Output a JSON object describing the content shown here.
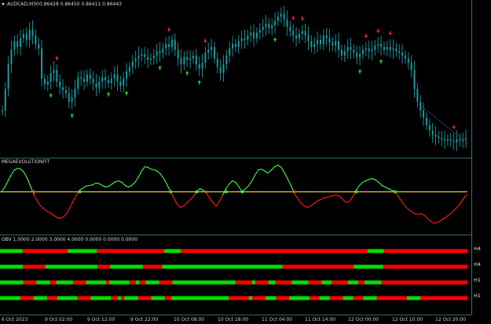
{
  "colors": {
    "background": "#000000",
    "grid": "#4c8a8a",
    "candles": "#1c9aa0",
    "up_arrow": "#22e022",
    "down_arrow": "#ff2020",
    "oscillator_up": "#44ff44",
    "oscillator_down": "#ff1c1c",
    "zero_line": "#e8c83c",
    "strip_green": "#00e000",
    "strip_red": "#ff0000"
  },
  "price_panel": {
    "title": "AUDCAD,M30",
    "ohlc": "0.86428 0.86450 0.86411 0.86443",
    "collapse_icon": "triangle-down-icon"
  },
  "oscillator_panel": {
    "title": "MEGAEVOLUTIONFIT"
  },
  "strip_panel": {
    "title": "OBV  1.0000  2.0000  3.0000  4.0000  0.0000  0.0000  0.0000",
    "rows": [
      {
        "label": "H4",
        "pattern": "gggggggrrrrrrrrrrrrrrgggggggggrrrrrrrrrrrrrrrrrrrrrgggggrrrrrrrrrrrrrrrrrrrrrrrrrrrrrrrrrrrrrrrrrrrrrrrrrrrrrrrrrrgggggrrrrrrrrrrrrrrrrrrrrrrrrrr"
      },
      {
        "label": "H4",
        "pattern": "gggggggrrrrrrrggggggggggggggggrrrrggggggggggrrrrrrgggggggggggggggggggggggggggggggggggggrrrrrrrrrrrrrrrrrrrrrrgggggggggrrrrrrrrrrrrrrrrrrrrrrrrrr"
      },
      {
        "label": "H1",
        "pattern": "gggggggrrrrggggrrgggggrrrrggggggrggggggrrgrrggggrrrrgggggggggggggggggggrrrrrgrrrrggrrrrrgggggrrrrgggrrrrrgggrrgggggrrrrrrrrrrrrrrrrrrrrrrrrrr"
      },
      {
        "label": "H1",
        "pattern": "ggggggrrrrggggrrrggggggrrrrggggggrrgrggggrrrrggggrrgggggggggggggggggrrrrrrgrrrrgggrrrrggggggrrrgggrrrrgggrrrggggrrrrrrrrrggggrrrrrrrrrrrrrr"
      }
    ]
  },
  "time_axis": [
    "6 Oct 2023",
    "9 Oct 02:00",
    "9 Oct 12:00",
    "9 Oct 22:00",
    "10 Oct 08:00",
    "10 Oct 18:00",
    "11 Oct 04:00",
    "11 Oct 14:00",
    "12 Oct 00:00",
    "12 Oct 10:00",
    "12 Oct 20:00"
  ],
  "chart_data": [
    {
      "type": "candlestick",
      "symbol": "AUDCAD",
      "timeframe": "M30",
      "closes": [
        0.3,
        0.45,
        0.62,
        0.72,
        0.78,
        0.74,
        0.8,
        0.83,
        0.79,
        0.86,
        0.82,
        0.76,
        0.73,
        0.52,
        0.48,
        0.5,
        0.56,
        0.58,
        0.5,
        0.46,
        0.44,
        0.42,
        0.36,
        0.39,
        0.45,
        0.53,
        0.52,
        0.5,
        0.55,
        0.52,
        0.49,
        0.46,
        0.5,
        0.53,
        0.51,
        0.49,
        0.52,
        0.55,
        0.5,
        0.47,
        0.52,
        0.57,
        0.6,
        0.64,
        0.66,
        0.68,
        0.69,
        0.67,
        0.65,
        0.66,
        0.68,
        0.71,
        0.7,
        0.73,
        0.76,
        0.74,
        0.79,
        0.72,
        0.66,
        0.62,
        0.67,
        0.65,
        0.66,
        0.68,
        0.62,
        0.59,
        0.63,
        0.7,
        0.72,
        0.74,
        0.66,
        0.6,
        0.56,
        0.62,
        0.68,
        0.73,
        0.76,
        0.74,
        0.78,
        0.8,
        0.79,
        0.82,
        0.84,
        0.8,
        0.84,
        0.86,
        0.88,
        0.9,
        0.87,
        0.89,
        0.92,
        0.95,
        0.97,
        0.93,
        0.88,
        0.85,
        0.82,
        0.8,
        0.83,
        0.85,
        0.82,
        0.78,
        0.74,
        0.76,
        0.79,
        0.76,
        0.82,
        0.8,
        0.77,
        0.75,
        0.78,
        0.72,
        0.68,
        0.71,
        0.74,
        0.72,
        0.7,
        0.67,
        0.69,
        0.72,
        0.73,
        0.71,
        0.72,
        0.75,
        0.76,
        0.74,
        0.72,
        0.74,
        0.72,
        0.73,
        0.71,
        0.7,
        0.68,
        0.66,
        0.63,
        0.58,
        0.45,
        0.36,
        0.3,
        0.25,
        0.2,
        0.16,
        0.13,
        0.12,
        0.11,
        0.1,
        0.09,
        0.1,
        0.09,
        0.08,
        0.1,
        0.09,
        0.1,
        0.11
      ]
    },
    {
      "type": "line",
      "name": "MEGAEVOLUTIONFIT",
      "zero_level": 0,
      "values": [
        0,
        0.15,
        0.35,
        0.55,
        0.7,
        0.75,
        0.72,
        0.6,
        0.4,
        0.15,
        -0.1,
        -0.3,
        -0.45,
        -0.55,
        -0.62,
        -0.68,
        -0.75,
        -0.82,
        -0.85,
        -0.8,
        -0.7,
        -0.5,
        -0.3,
        -0.1,
        0.05,
        0.12,
        0.18,
        0.2,
        0.22,
        0.28,
        0.26,
        0.2,
        0.15,
        0.18,
        0.25,
        0.32,
        0.35,
        0.3,
        0.2,
        0.15,
        0.2,
        0.3,
        0.45,
        0.65,
        0.8,
        0.78,
        0.72,
        0.7,
        0.65,
        0.55,
        0.4,
        0.2,
        0.0,
        -0.2,
        -0.4,
        -0.5,
        -0.45,
        -0.35,
        -0.25,
        -0.15,
        0.0,
        0.1,
        0.05,
        -0.05,
        -0.2,
        -0.35,
        -0.45,
        -0.3,
        -0.1,
        0.1,
        0.25,
        0.35,
        0.3,
        0.15,
        0.0,
        0.1,
        0.2,
        0.35,
        0.55,
        0.7,
        0.72,
        0.65,
        0.6,
        0.7,
        0.8,
        0.85,
        0.78,
        0.6,
        0.4,
        0.2,
        -0.05,
        -0.2,
        -0.35,
        -0.45,
        -0.5,
        -0.45,
        -0.38,
        -0.3,
        -0.25,
        -0.2,
        -0.18,
        -0.15,
        -0.12,
        -0.1,
        -0.15,
        -0.25,
        -0.35,
        -0.3,
        -0.15,
        0.05,
        0.2,
        0.3,
        0.35,
        0.4,
        0.42,
        0.38,
        0.3,
        0.2,
        0.15,
        0.1,
        0.05,
        0.0,
        -0.15,
        -0.3,
        -0.45,
        -0.55,
        -0.62,
        -0.7,
        -0.72,
        -0.7,
        -0.75,
        -0.85,
        -0.95,
        -1.0,
        -0.98,
        -0.92,
        -0.85,
        -0.78,
        -0.7,
        -0.6,
        -0.5,
        -0.38,
        -0.22,
        -0.1
      ]
    }
  ]
}
